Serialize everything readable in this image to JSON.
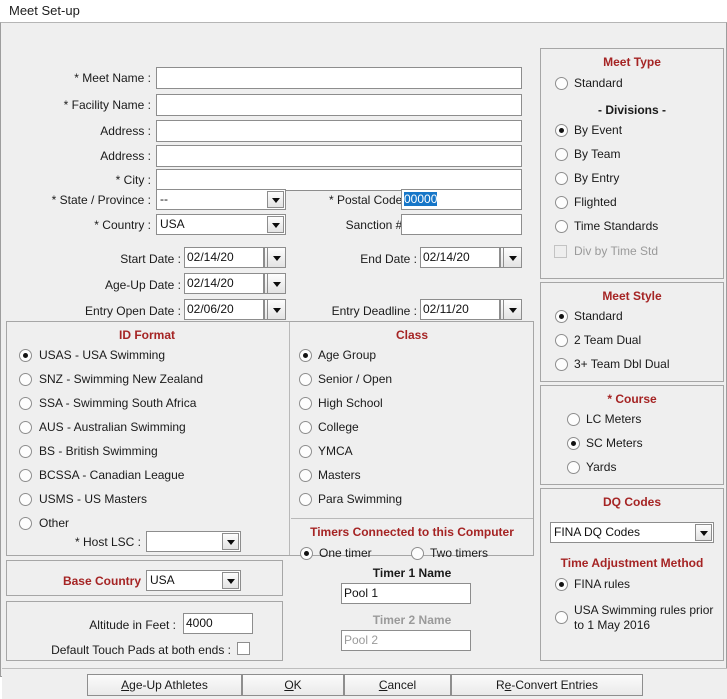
{
  "window": {
    "title": "Meet Set-up"
  },
  "form": {
    "meet_name": {
      "label": "* Meet Name :",
      "value": ""
    },
    "facility_name": {
      "label": "* Facility Name :",
      "value": ""
    },
    "address1": {
      "label": "Address :",
      "value": ""
    },
    "address2": {
      "label": "Address :",
      "value": ""
    },
    "city": {
      "label": "* City :",
      "value": ""
    },
    "state": {
      "label": "* State / Province :",
      "value": "--"
    },
    "country": {
      "label": "* Country :",
      "value": "USA"
    },
    "postal_code": {
      "label": "* Postal Code :",
      "value": "00000",
      "selected": true
    },
    "sanction": {
      "label": "Sanction # :",
      "value": ""
    },
    "start_date": {
      "label": "Start Date :",
      "value": "02/14/20"
    },
    "end_date": {
      "label": "End Date :",
      "value": "02/14/20"
    },
    "age_up_date": {
      "label": "Age-Up Date :",
      "value": "02/14/20"
    },
    "entry_open_date": {
      "label": "Entry Open Date :",
      "value": "02/06/20"
    },
    "entry_deadline": {
      "label": "Entry Deadline :",
      "value": "02/11/20"
    }
  },
  "id_format": {
    "legend": "ID Format",
    "options": [
      {
        "label": "USAS - USA Swimming",
        "selected": true
      },
      {
        "label": "SNZ - Swimming New Zealand",
        "selected": false
      },
      {
        "label": "SSA - Swimming South Africa",
        "selected": false
      },
      {
        "label": "AUS - Australian Swimming",
        "selected": false
      },
      {
        "label": "BS - British Swimming",
        "selected": false
      },
      {
        "label": "BCSSA - Canadian League",
        "selected": false
      },
      {
        "label": "USMS - US Masters",
        "selected": false
      },
      {
        "label": "Other",
        "selected": false
      }
    ],
    "host_lsc": {
      "label": "* Host LSC :",
      "value": ""
    }
  },
  "base_country": {
    "legend": "Base Country",
    "value": "USA"
  },
  "altitude": {
    "label": "Altitude in Feet :",
    "value": "4000",
    "touch_pads_label": "Default Touch Pads at both ends :",
    "touch_pads_checked": false
  },
  "class": {
    "legend": "Class",
    "options": [
      {
        "label": "Age Group",
        "selected": true
      },
      {
        "label": "Senior / Open",
        "selected": false
      },
      {
        "label": "High School",
        "selected": false
      },
      {
        "label": "College",
        "selected": false
      },
      {
        "label": "YMCA",
        "selected": false
      },
      {
        "label": "Masters",
        "selected": false
      },
      {
        "label": "Para Swimming",
        "selected": false
      }
    ]
  },
  "timers": {
    "legend": "Timers Connected to this Computer",
    "one_timer": {
      "label": "One timer",
      "selected": true
    },
    "two_timers": {
      "label": "Two timers",
      "selected": false
    },
    "timer1": {
      "label": "Timer 1 Name",
      "value": "Pool 1",
      "disabled": false
    },
    "timer2": {
      "label": "Timer 2 Name",
      "value": "Pool 2",
      "disabled": true
    }
  },
  "meet_type": {
    "legend": "Meet Type",
    "standard": {
      "label": "Standard",
      "selected": false
    },
    "divisions_header": "- Divisions -",
    "options": [
      {
        "label": "By Event",
        "selected": true
      },
      {
        "label": "By Team",
        "selected": false
      },
      {
        "label": "By Entry",
        "selected": false
      },
      {
        "label": "Flighted",
        "selected": false
      },
      {
        "label": "Time Standards",
        "selected": false
      }
    ],
    "div_by_time_std": {
      "label": "Div by Time Std",
      "checked": false,
      "disabled": true
    }
  },
  "meet_style": {
    "legend": "Meet Style",
    "options": [
      {
        "label": "Standard",
        "selected": true
      },
      {
        "label": "2 Team Dual",
        "selected": false
      },
      {
        "label": "3+ Team Dbl Dual",
        "selected": false
      }
    ]
  },
  "course": {
    "legend": "* Course",
    "options": [
      {
        "label": "LC Meters",
        "selected": false
      },
      {
        "label": "SC Meters",
        "selected": true
      },
      {
        "label": "Yards",
        "selected": false
      }
    ]
  },
  "dq_codes": {
    "legend": "DQ Codes",
    "value": "FINA DQ Codes"
  },
  "time_adjustment": {
    "legend": "Time Adjustment Method",
    "options": [
      {
        "label": "FINA rules",
        "selected": true
      },
      {
        "label": "USA Swimming rules prior to 1 May 2016",
        "selected": false
      }
    ]
  },
  "buttons": {
    "age_up": {
      "accel": "A",
      "rest": "ge-Up Athletes"
    },
    "ok": {
      "accel": "O",
      "rest": "K"
    },
    "cancel": {
      "accel": "C",
      "rest": "ancel"
    },
    "re_convert": {
      "pre": "R",
      "accel": "e",
      "rest": "-Convert Entries"
    }
  },
  "colors": {
    "legend": "#a52424",
    "selection": "#1676c8",
    "face": "#efefef"
  }
}
